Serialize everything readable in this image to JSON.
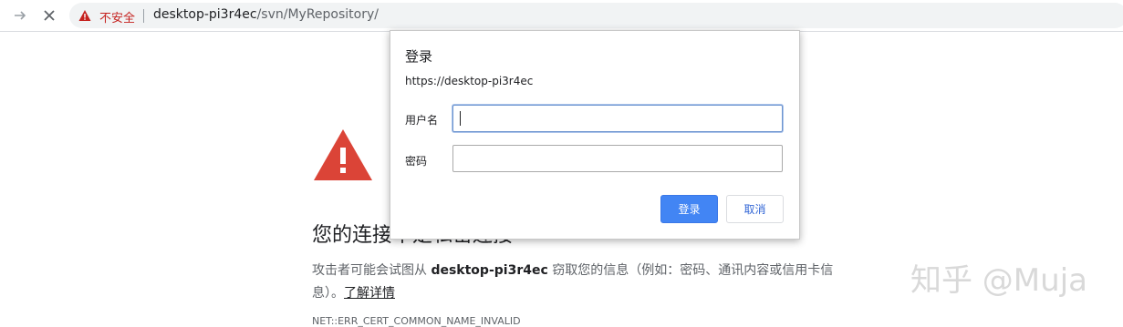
{
  "browser": {
    "security_label": "不安全",
    "url_host": "desktop-pi3r4ec",
    "url_path": "/svn/MyRepository/"
  },
  "error_page": {
    "title": "您的连接不是私密连接",
    "body_prefix": "攻击者可能会试图从",
    "body_host": "desktop-pi3r4ec",
    "body_suffix": "窃取您的信息（例如：密码、通讯内容或信用卡信息）。",
    "learn_more": "了解详情",
    "error_code": "NET::ERR_CERT_COMMON_NAME_INVALID"
  },
  "dialog": {
    "title": "登录",
    "origin": "https://desktop-pi3r4ec",
    "username_label": "用户名",
    "username_value": "",
    "password_label": "密码",
    "password_value": "",
    "login_button": "登录",
    "cancel_button": "取消"
  },
  "watermark": "知乎 @Muja",
  "colors": {
    "danger": "#db4437",
    "insecure_text": "#c5221f",
    "primary_button": "#4285f4"
  }
}
